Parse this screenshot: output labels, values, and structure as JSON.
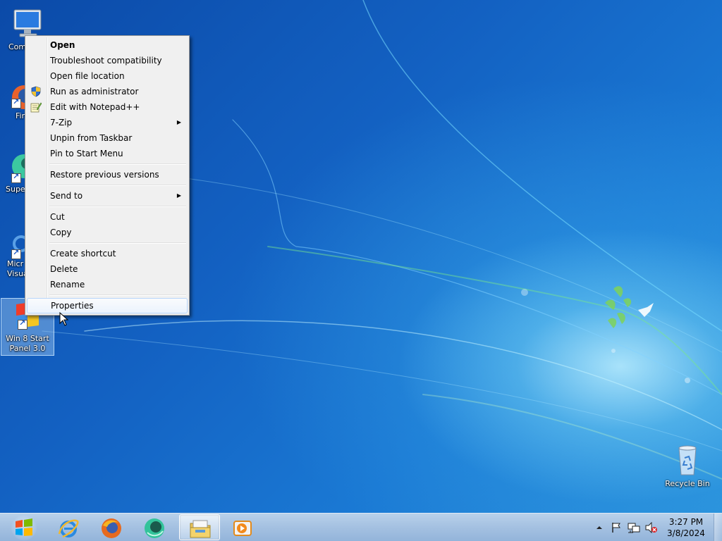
{
  "desktop": {
    "icons": [
      {
        "label": "Com"
      },
      {
        "label": "Fir"
      },
      {
        "label": "Supe"
      },
      {
        "label": "Micr\nVisual"
      },
      {
        "label": "Win 8 Start\nPanel 3.0"
      },
      {
        "label": "Recycle Bin"
      }
    ]
  },
  "context_menu": {
    "items": [
      {
        "label": "Open"
      },
      {
        "label": "Troubleshoot compatibility"
      },
      {
        "label": "Open file location"
      },
      {
        "label": "Run as administrator"
      },
      {
        "label": "Edit with Notepad++"
      },
      {
        "label": "7-Zip"
      },
      {
        "label": "Unpin from Taskbar"
      },
      {
        "label": "Pin to Start Menu"
      },
      {
        "label": "Restore previous versions"
      },
      {
        "label": "Send to"
      },
      {
        "label": "Cut"
      },
      {
        "label": "Copy"
      },
      {
        "label": "Create shortcut"
      },
      {
        "label": "Delete"
      },
      {
        "label": "Rename"
      },
      {
        "label": "Properties"
      }
    ]
  },
  "taskbar": {
    "clock_time": "3:27 PM",
    "clock_date": "3/8/2024"
  },
  "colors": {
    "wallpaper": "#1466c4",
    "taskbar": "#a6c2e2",
    "menu_bg": "#f0f0f0",
    "menu_highlight": "#ebf3fd"
  }
}
